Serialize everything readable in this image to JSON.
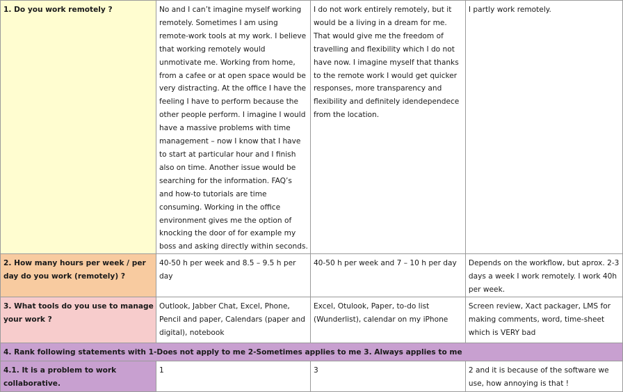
{
  "rows": [
    {
      "question": "1. Do you work remotely ?",
      "answers": [
        "No and I can’t imagine myself working remotely. Sometimes I am using remote-work tools at my work. I believe that working remotely would unmotivate me. Working from home, from a cafee or at open space would be very distracting. At the office I have the feeling I have to perform because the  other people perform. I imagine I would have a massive problems with time management – now I know that I have to start at particular hour and I finish also on time. Another issue would be searching for the information. FAQ’s and how-to tutorials are time consuming. Working in the office environment gives me the option of knocking the door of for example my boss and asking directly within seconds.",
        "I do not work entirely remotely, but it would be a living in a dream for me. That would give me the freedom of travelling and flexibility which I do not have now. I imagine myself that thanks to the remote work I would get quicker responses, more transparency and flexibility and definitely idendependece from the location.",
        "I partly work remotely."
      ]
    },
    {
      "question": "2. How many hours per week / per day do you work (remotely) ?",
      "answers": [
        "40-50 h per week and 8.5 – 9.5 h per day",
        "40-50 h per week and 7 – 10 h per day",
        "Depends on the workflow, but aprox. 2-3 days a week I work remotely. I work 40h per week."
      ]
    },
    {
      "question": "3. What tools do you use to manage your work ?",
      "answers": [
        "Outlook, Jabber Chat, Excel, Phone, Pencil and paper, Calendars (paper and digital), notebook",
        "Excel, Otulook, Paper, to-do list (Wunderlist), calendar on my iPhone",
        "Screen review, Xact packager, LMS for making comments, word, time-sheet which is VERY bad"
      ]
    },
    {
      "section": "4. Rank following statements with 1-Does not apply to me 2-Sometimes applies to me 3. Always applies to me"
    },
    {
      "question": "4.1. It is a problem to work collaborative.",
      "answers": [
        "1",
        "3",
        "2 and it is because of the software we use, how annoying is that !"
      ]
    }
  ],
  "colors": {
    "q1": "#fffdd0",
    "q2": "#f8cba0",
    "q3": "#f7cccc",
    "section": "#c8a0d0",
    "grid": "#9a9a9a"
  }
}
